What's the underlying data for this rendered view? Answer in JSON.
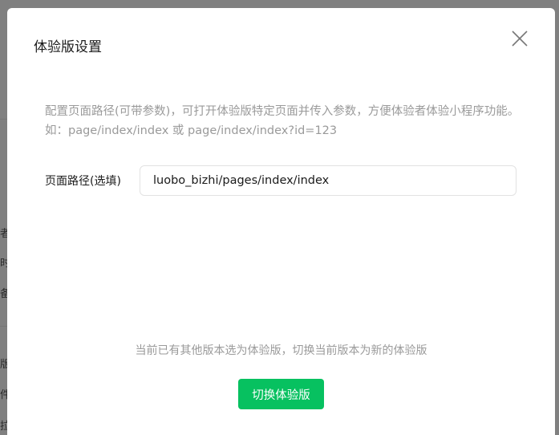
{
  "background": {
    "edge_chars": [
      "者",
      "时",
      "备",
      "版",
      "件",
      "拉"
    ]
  },
  "dialog": {
    "title": "体验版设置",
    "description": "配置页面路径(可带参数)，可打开体验版特定页面并传入参数，方便体验者体验小程序功能。如：page/index/index 或 page/index/index?id=123",
    "path_label": "页面路径(选填)",
    "path_value": "luobo_bizhi/pages/index/index",
    "notice": "当前已有其他版本选为体验版，切换当前版本为新的体验版",
    "switch_button": "切换体验版",
    "close_icon": "close-icon"
  },
  "colors": {
    "primary": "#07c160",
    "overlay": "#808080",
    "muted_text": "#9a9a9a"
  }
}
